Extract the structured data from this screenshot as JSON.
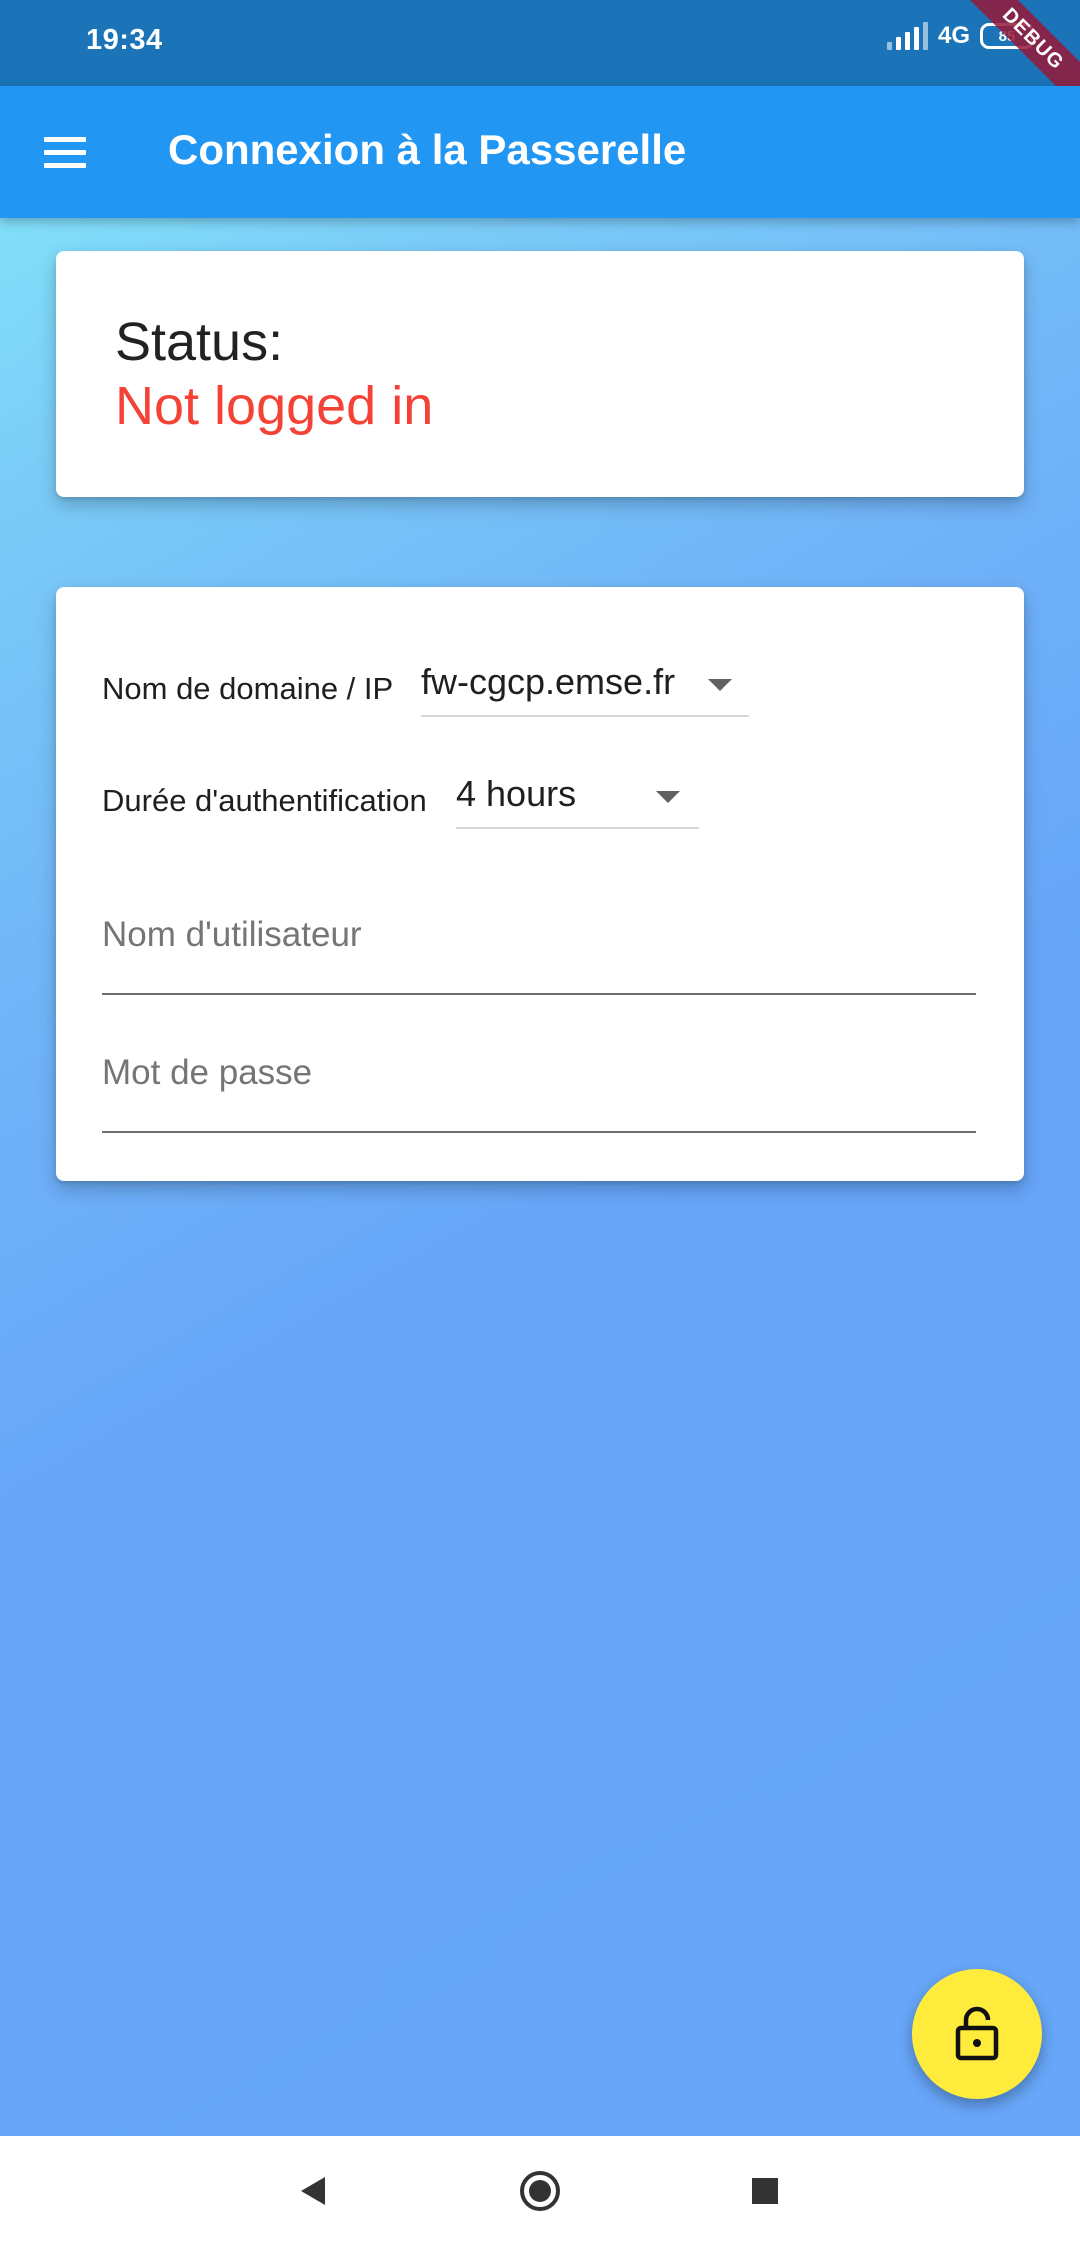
{
  "status_bar": {
    "time": "19:34",
    "network": "4G",
    "battery": "85",
    "debug_banner": "DEBUG"
  },
  "app_bar": {
    "title": "Connexion à la Passerelle",
    "menu_icon": "menu-icon"
  },
  "status_card": {
    "label": "Status:",
    "value": "Not logged in",
    "value_color": "#F44336"
  },
  "form": {
    "domain": {
      "label": "Nom de domaine / IP",
      "selected": "fw-cgcp.emse.fr"
    },
    "duration": {
      "label": "Durée d'authentification",
      "selected": "4 hours"
    },
    "username": {
      "placeholder": "Nom d'utilisateur",
      "value": ""
    },
    "password": {
      "placeholder": "Mot de passe",
      "value": ""
    }
  },
  "fab": {
    "icon": "lock-open-icon",
    "color": "#FFEB3B"
  },
  "nav_bar": {
    "back_icon": "back-triangle-icon",
    "home_icon": "home-circle-icon",
    "recents_icon": "recents-square-icon"
  },
  "colors": {
    "app_bar": "#2196F3",
    "status_bar": "#1B74B8"
  }
}
